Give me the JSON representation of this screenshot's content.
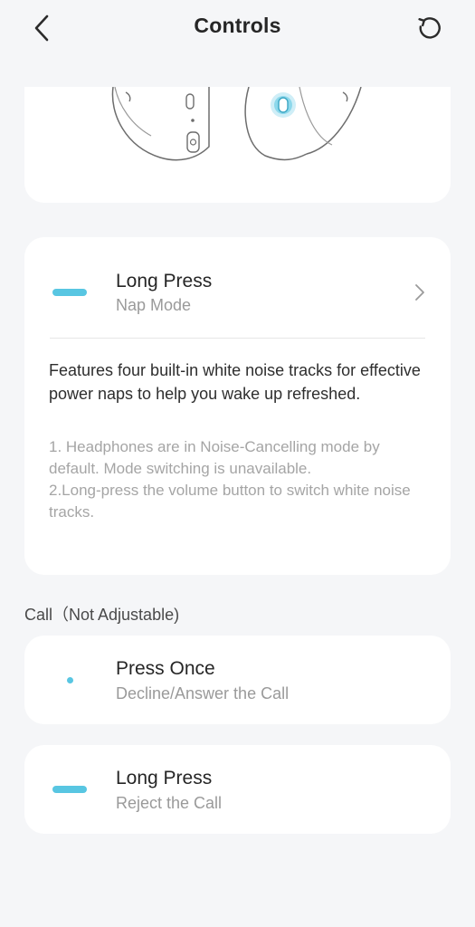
{
  "header": {
    "title": "Controls",
    "back_icon": "chevron-left-icon",
    "reset_icon": "reset-icon"
  },
  "image": {
    "description_icon": "headphones-illustration",
    "highlight_color": "#58c6e2"
  },
  "mode_card": {
    "title": "Long Press",
    "subtitle": "Nap Mode",
    "description": "Features four built-in white noise tracks for effective power naps to help you wake up refreshed.",
    "note_1": "1. Headphones are in Noise-Cancelling mode by default. Mode switching is unavailable.",
    "note_2": "2.Long-press the volume button to switch white noise tracks."
  },
  "call_section": {
    "label": "Call（Not Adjustable)",
    "items": [
      {
        "title": "Press Once",
        "subtitle": "Decline/Answer the Call"
      },
      {
        "title": "Long Press",
        "subtitle": "Reject the Call"
      }
    ]
  },
  "colors": {
    "accent": "#58c6e2",
    "background": "#f5f6f8",
    "card": "#ffffff"
  }
}
